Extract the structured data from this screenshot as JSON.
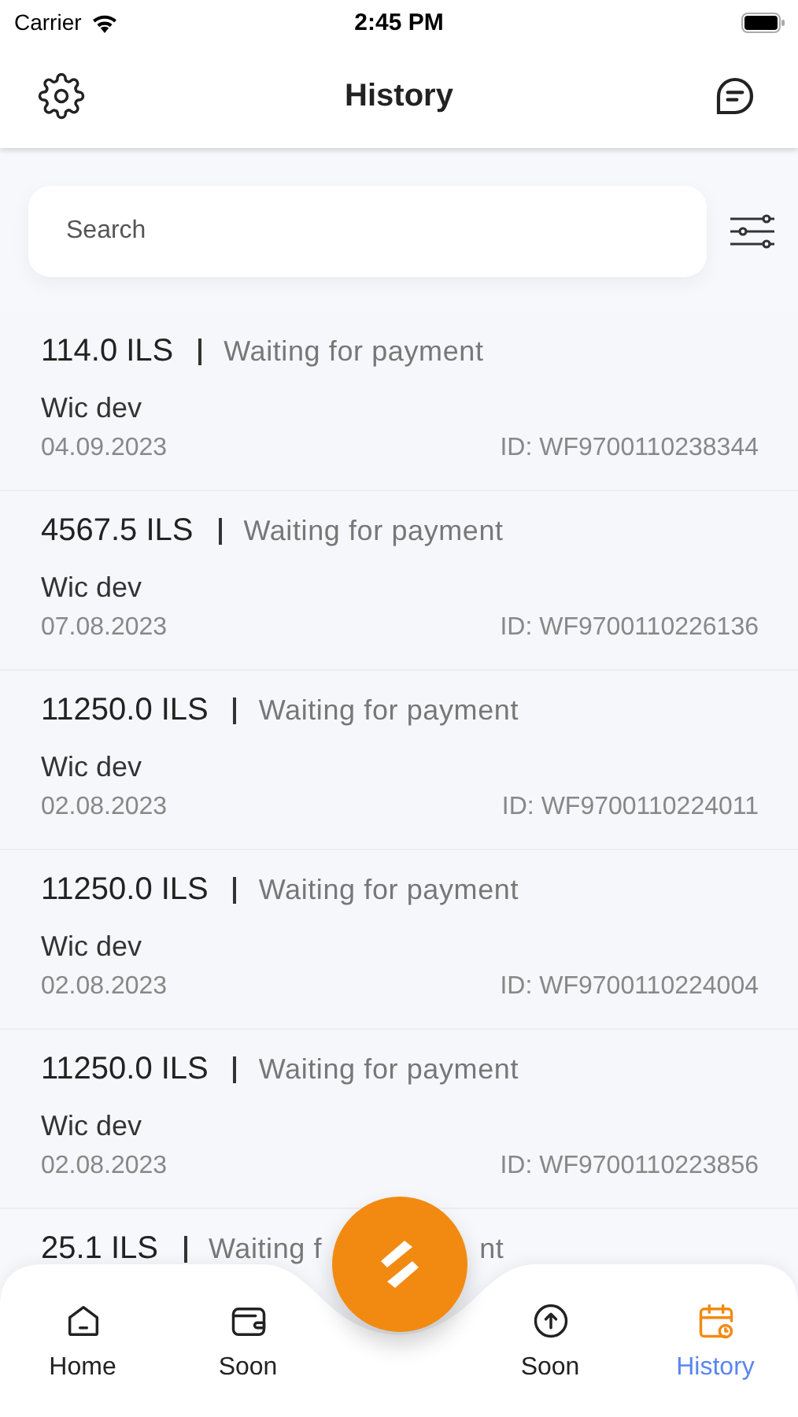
{
  "status_bar": {
    "carrier": "Carrier",
    "time": "2:45 PM"
  },
  "header": {
    "title": "History"
  },
  "search": {
    "placeholder": "Search"
  },
  "transactions": [
    {
      "amount": "114.0 ILS",
      "status": "Waiting for payment",
      "merchant": "Wic dev",
      "date": "04.09.2023",
      "id": "ID: WF9700110238344"
    },
    {
      "amount": "4567.5 ILS",
      "status": "Waiting for payment",
      "merchant": "Wic dev",
      "date": "07.08.2023",
      "id": "ID: WF9700110226136"
    },
    {
      "amount": "11250.0 ILS",
      "status": "Waiting for payment",
      "merchant": "Wic dev",
      "date": "02.08.2023",
      "id": "ID: WF9700110224011"
    },
    {
      "amount": "11250.0 ILS",
      "status": "Waiting for payment",
      "merchant": "Wic dev",
      "date": "02.08.2023",
      "id": "ID: WF9700110224004"
    },
    {
      "amount": "11250.0 ILS",
      "status": "Waiting for payment",
      "merchant": "Wic dev",
      "date": "02.08.2023",
      "id": "ID: WF9700110223856"
    }
  ],
  "partial_row": {
    "amount": "25.1 ILS",
    "status_start": "Waiting f",
    "status_end": "nt"
  },
  "tab_bar": [
    {
      "kind": "home",
      "label": "Home",
      "selected": false
    },
    {
      "kind": "wallet",
      "label": "Soon",
      "selected": false
    },
    {
      "kind": "gap"
    },
    {
      "kind": "upload",
      "label": "Soon",
      "selected": false
    },
    {
      "kind": "calendar",
      "label": "History",
      "selected": true
    }
  ]
}
